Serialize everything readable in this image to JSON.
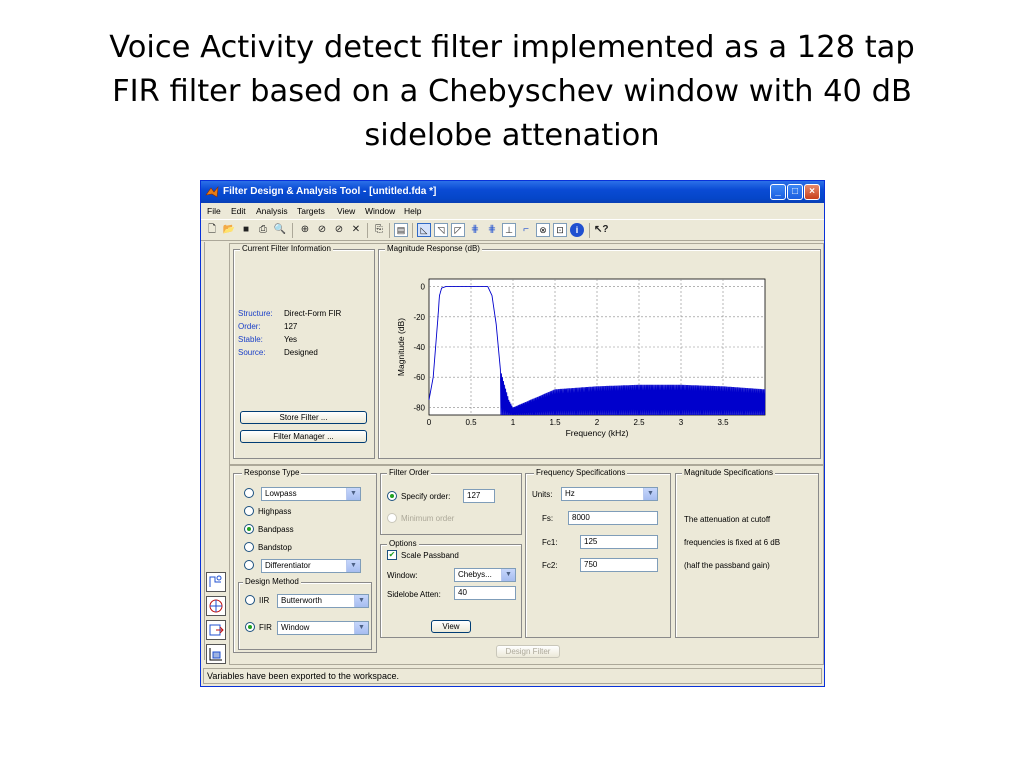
{
  "slide": {
    "title_lines": [
      "Voice Activity detect filter implemented as a 128 tap",
      "FIR filter based on a Chebyschev window with 40 dB",
      "sidelobe attenation"
    ]
  },
  "window": {
    "title": "Filter Design & Analysis Tool -  [untitled.fda *]",
    "controls": {
      "minimize": "_",
      "maximize": "□",
      "close": "×"
    }
  },
  "menu": [
    "File",
    "Edit",
    "Analysis",
    "Targets",
    "View",
    "Window",
    "Help"
  ],
  "toolbar": {
    "icons": [
      "new-icon",
      "open-icon",
      "save-icon",
      "print-icon",
      "print-preview-icon",
      "zoom-in-icon",
      "zoom-x-icon",
      "zoom-y-icon",
      "full-view-icon",
      "full-view-analysis-icon",
      "legend-icon",
      "magnitude-response-icon",
      "phase-response-icon",
      "magnitude-phase-icon",
      "group-delay-icon",
      "phase-delay-icon",
      "impulse-response-icon",
      "step-response-icon",
      "pole-zero-icon",
      "filter-coefficients-icon",
      "filter-info-icon",
      "whats-this-icon"
    ]
  },
  "filter_info": {
    "legend": "Current Filter Information",
    "rows": [
      {
        "key": "Structure:",
        "value": "Direct-Form FIR"
      },
      {
        "key": "Order:",
        "value": "127"
      },
      {
        "key": "Stable:",
        "value": "Yes"
      },
      {
        "key": "Source:",
        "value": "Designed"
      }
    ],
    "store_button": "Store Filter ...",
    "manager_button": "Filter Manager ..."
  },
  "magnitude_plot": {
    "legend": "Magnitude Response (dB)"
  },
  "chart_data": {
    "type": "line",
    "title": "",
    "xlabel": "Frequency (kHz)",
    "ylabel": "Magnitude (dB)",
    "xlim": [
      0,
      4
    ],
    "ylim": [
      -85,
      5
    ],
    "xticks": [
      "0",
      "0.5",
      "1",
      "1.5",
      "2",
      "2.5",
      "3",
      "3.5"
    ],
    "yticks": [
      "0",
      "-20",
      "-40",
      "-60",
      "-80"
    ],
    "grid": true,
    "line_color": "#0000cc",
    "series": [
      {
        "x": [
          0,
          0.05,
          0.1,
          0.125,
          0.15,
          0.2,
          0.3,
          0.5,
          0.65,
          0.7,
          0.75,
          0.8,
          0.85,
          0.9,
          0.95,
          1.0,
          1.5,
          2.0,
          2.5,
          3.0,
          3.5,
          4.0
        ],
        "y": [
          -75,
          -60,
          -25,
          -6,
          -1,
          0,
          0,
          0,
          0,
          0,
          -6,
          -25,
          -55,
          -65,
          -75,
          -80,
          -68,
          -66,
          -65,
          -65,
          -66,
          -68
        ]
      }
    ]
  },
  "response_type": {
    "legend": "Response Type",
    "options": [
      {
        "label": "Lowpass",
        "kind": "select",
        "checked": false
      },
      {
        "label": "Highpass",
        "kind": "radio",
        "checked": false
      },
      {
        "label": "Bandpass",
        "kind": "radio",
        "checked": true
      },
      {
        "label": "Bandstop",
        "kind": "radio",
        "checked": false
      },
      {
        "label": "Differentiator",
        "kind": "select",
        "checked": false
      }
    ]
  },
  "design_method": {
    "legend": "Design Method",
    "iir_label": "IIR",
    "iir_value": "Butterworth",
    "fir_label": "FIR",
    "fir_value": "Window"
  },
  "filter_order": {
    "legend": "Filter Order",
    "specify_label": "Specify order:",
    "specify_value": "127",
    "minimum_label": "Minimum order"
  },
  "options": {
    "legend": "Options",
    "scale_passband": "Scale Passband",
    "window_label": "Window:",
    "window_value": "Chebys...",
    "sidelobe_label": "Sidelobe Atten:",
    "sidelobe_value": "40",
    "view_button": "View"
  },
  "freq_specs": {
    "legend": "Frequency Specifications",
    "units_label": "Units:",
    "units_value": "Hz",
    "fs_label": "Fs:",
    "fs_value": "8000",
    "fc1_label": "Fc1:",
    "fc1_value": "125",
    "fc2_label": "Fc2:",
    "fc2_value": "750"
  },
  "mag_specs": {
    "legend": "Magnitude Specifications",
    "lines": [
      "The attenuation at cutoff",
      "frequencies is fixed at 6 dB",
      "(half the passband gain)"
    ]
  },
  "design_button": "Design Filter",
  "status": "Variables have been exported to the workspace."
}
